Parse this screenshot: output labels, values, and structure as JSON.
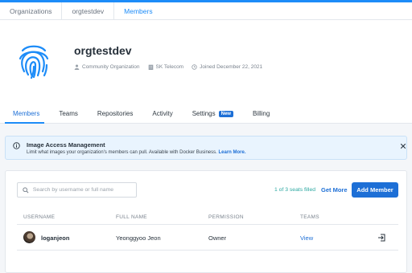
{
  "breadcrumb": {
    "items": [
      "Organizations",
      "orgtestdev",
      "Members"
    ]
  },
  "org": {
    "name": "orgtestdev",
    "meta": {
      "type": "Community Organization",
      "company": "SK Telecom",
      "joined": "Joined December 22, 2021"
    }
  },
  "tabs": [
    {
      "label": "Members",
      "active": true
    },
    {
      "label": "Teams"
    },
    {
      "label": "Repositories"
    },
    {
      "label": "Activity"
    },
    {
      "label": "Settings",
      "badge": "New"
    },
    {
      "label": "Billing"
    }
  ],
  "banner": {
    "title": "Image Access Management",
    "body": "Limit what images your organization's members can pull. Available with Docker Business.",
    "link": "Learn More."
  },
  "members": {
    "search_placeholder": "Search by username or full name",
    "seats": "1 of 3 seats filled",
    "get_more": "Get More",
    "add_member": "Add Member",
    "columns": [
      "USERNAME",
      "FULL NAME",
      "PERMISSION",
      "TEAMS"
    ],
    "rows": [
      {
        "username": "loganjeon",
        "full_name": "Yeonggyoo Jeon",
        "permission": "Owner",
        "teams": "View"
      }
    ]
  },
  "colors": {
    "accent": "#1d8cf8",
    "primary_button": "#1d6fd6",
    "banner_bg": "#e9f4fe",
    "seats_text": "#2aa7a0"
  },
  "icons": {
    "org_logo": "fingerprint-icon",
    "type": "user-icon",
    "company": "building-icon",
    "joined": "clock-icon",
    "banner": "info-icon",
    "close": "close-icon",
    "search": "search-icon",
    "row_action": "leave-icon"
  }
}
